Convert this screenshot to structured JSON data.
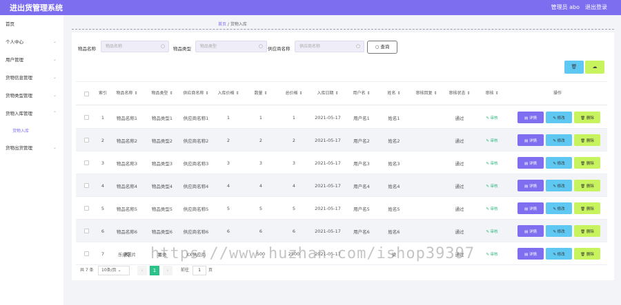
{
  "app": {
    "title": "进出货管理系统",
    "user": "管理员 abo",
    "logout": "退出登录"
  },
  "sidebar": {
    "items": [
      {
        "label": "首页",
        "arrow": ""
      },
      {
        "label": "个人中心",
        "arrow": "⌄"
      },
      {
        "label": "用户管理",
        "arrow": "⌄"
      },
      {
        "label": "货物信息管理",
        "arrow": "⌄"
      },
      {
        "label": "货物类型管理",
        "arrow": "⌄"
      },
      {
        "label": "货物入库管理",
        "arrow": "⌃"
      },
      {
        "label": "货物出货管理",
        "arrow": "⌄"
      }
    ],
    "sub_label": "货物入库"
  },
  "breadcrumb": {
    "home": "首页",
    "sep": "/",
    "current": "货物入库"
  },
  "filters": {
    "name_label": "物品名称",
    "name_placeholder": "物品名称",
    "type_label": "物品类型",
    "type_placeholder": "物品类型",
    "supplier_label": "供应商名称",
    "supplier_placeholder": "供应商名称",
    "search_label": "查询"
  },
  "toolbar": {
    "delete_icon": "🗑",
    "export_icon": "☁"
  },
  "table": {
    "headers": [
      "索引",
      "物品名称 ⇕",
      "物品类型 ⇕",
      "供应商名称 ⇕",
      "入库价格 ⇕",
      "数量 ⇕",
      "总价格 ⇕",
      "入库日期 ⇕",
      "用户名 ⇕",
      "姓名 ⇕",
      "审核回复 ⇕",
      "审核状态 ⇕",
      "审核 ⇕",
      "操作"
    ],
    "rows": [
      [
        "1",
        "物品名称1",
        "物品类型1",
        "供应商名称1",
        "1",
        "1",
        "1",
        "2021-05-17",
        "用户名1",
        "姓名1",
        "",
        "通过"
      ],
      [
        "2",
        "物品名称2",
        "物品类型2",
        "供应商名称2",
        "2",
        "2",
        "2",
        "2021-05-17",
        "用户名2",
        "姓名2",
        "",
        "通过"
      ],
      [
        "3",
        "物品名称3",
        "物品类型3",
        "供应商名称3",
        "3",
        "3",
        "3",
        "2021-05-17",
        "用户名3",
        "姓名3",
        "",
        "通过"
      ],
      [
        "4",
        "物品名称4",
        "物品类型4",
        "供应商名称4",
        "4",
        "4",
        "4",
        "2021-05-17",
        "用户名4",
        "姓名4",
        "",
        "通过"
      ],
      [
        "5",
        "物品名称5",
        "物品类型5",
        "供应商名称5",
        "5",
        "5",
        "5",
        "2021-05-17",
        "用户名5",
        "姓名5",
        "",
        "通过"
      ],
      [
        "6",
        "物品名称6",
        "物品类型6",
        "供应商名称6",
        "6",
        "6",
        "6",
        "2021-05-17",
        "用户名6",
        "姓名6",
        "",
        "通过"
      ],
      [
        "7",
        "乐成署片",
        "薯类",
        "XX供应商",
        "",
        "500",
        "2500",
        "2021-05-17",
        "",
        "梁",
        "",
        "通过"
      ]
    ],
    "audit_label": "✎ 审核",
    "detail_label": "▤ 详情",
    "edit_label": "✎ 修改",
    "delete_label": "🗑 删除"
  },
  "pagination": {
    "total": "共 7 条",
    "page_size": "10条/页 ⌄",
    "prev": "‹",
    "current_page": "1",
    "next": "›",
    "goto_label": "前往",
    "goto_value": "1",
    "page_suffix": "页"
  },
  "watermark": "https://www.huzhan.com/ishop39397",
  "colors": {
    "primary": "#7d6ef0",
    "edit": "#5ec8f2",
    "delete": "#c7f35e",
    "pass": "#2db87d"
  }
}
